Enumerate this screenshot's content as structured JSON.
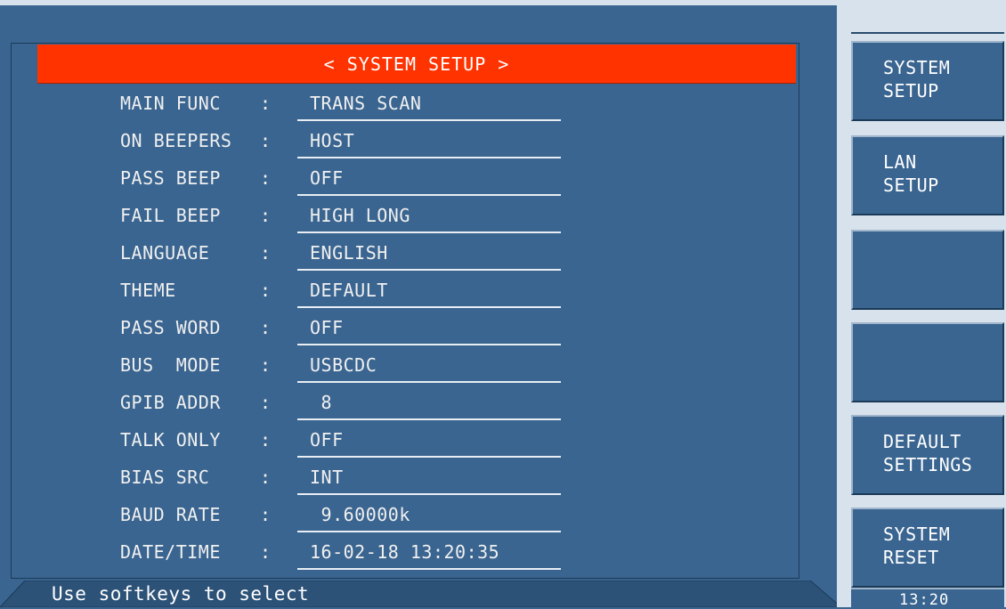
{
  "title": "< SYSTEM SETUP >",
  "settings": [
    {
      "label": "MAIN FUNC",
      "value": "TRANS SCAN"
    },
    {
      "label": "ON BEEPERS",
      "value": "HOST"
    },
    {
      "label": "PASS BEEP",
      "value": "OFF"
    },
    {
      "label": "FAIL BEEP",
      "value": "HIGH LONG"
    },
    {
      "label": "LANGUAGE",
      "value": "ENGLISH"
    },
    {
      "label": "THEME",
      "value": "DEFAULT"
    },
    {
      "label": "PASS WORD",
      "value": "OFF"
    },
    {
      "label": "BUS  MODE",
      "value": "USBCDC"
    },
    {
      "label": "GPIB ADDR",
      "value": " 8"
    },
    {
      "label": "TALK ONLY",
      "value": "OFF"
    },
    {
      "label": "BIAS SRC",
      "value": "INT"
    },
    {
      "label": "BAUD RATE",
      "value": " 9.60000k"
    },
    {
      "label": "DATE/TIME",
      "value": "16-02-18 13:20:35"
    }
  ],
  "colon": ":",
  "status": "Use softkeys to select",
  "softkeys": [
    {
      "line1": "SYSTEM",
      "line2": "SETUP"
    },
    {
      "line1": "LAN",
      "line2": "SETUP"
    },
    {
      "line1": "",
      "line2": ""
    },
    {
      "line1": "",
      "line2": ""
    },
    {
      "line1": "DEFAULT",
      "line2": "SETTINGS"
    },
    {
      "line1": "SYSTEM",
      "line2": "RESET"
    }
  ],
  "clock": "13:20",
  "colors": {
    "background": "#3a6590",
    "title_bar": "#ff3300",
    "softkey_frame": "#d8e2ec"
  }
}
